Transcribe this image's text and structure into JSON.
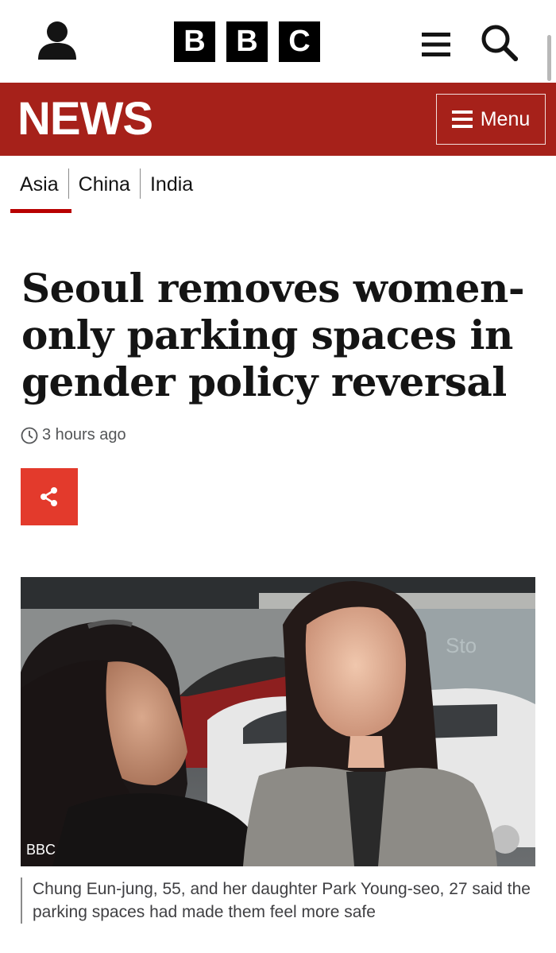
{
  "header": {
    "logo_letters": [
      "B",
      "B",
      "C"
    ],
    "icons": [
      "account-icon",
      "hamburger-icon",
      "search-icon"
    ]
  },
  "news_bar": {
    "title": "NEWS",
    "menu_label": "Menu",
    "background": "#a6211a"
  },
  "subnav": {
    "items": [
      "Asia",
      "China",
      "India"
    ],
    "active": "Asia",
    "accent": "#b80000"
  },
  "article": {
    "headline": "Seoul removes women-only parking spaces in gender policy reversal",
    "timestamp": "3 hours ago",
    "share_color": "#e33a2c",
    "image_credit": "BBC",
    "caption": "Chung Eun-jung, 55, and her daughter Park Young-seo, 27 said the parking spaces had made them feel more safe"
  }
}
